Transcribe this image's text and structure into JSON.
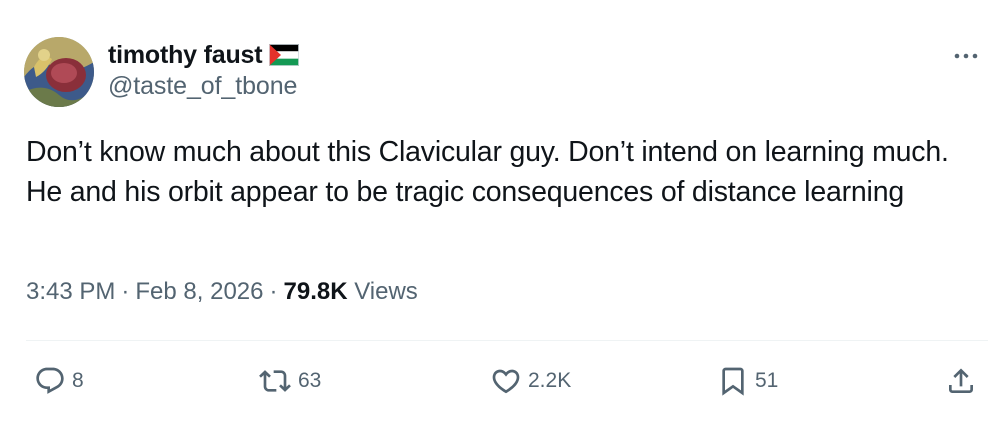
{
  "author": {
    "display_name": "timothy faust",
    "handle": "@taste_of_tbone",
    "flag_icon": "palestine-flag-icon",
    "avatar": "avatar-image"
  },
  "tweet": {
    "text": "Don’t know much about this Clavicular guy. Don’t intend on learning much. He and his orbit appear to be tragic consequences of distance learning"
  },
  "meta": {
    "time": "3:43 PM",
    "separator": "·",
    "date": "Feb 8, 2026",
    "views_count": "79.8K",
    "views_label": "Views"
  },
  "actions": {
    "reply": {
      "icon": "reply-icon",
      "count": "8"
    },
    "retweet": {
      "icon": "retweet-icon",
      "count": "63"
    },
    "like": {
      "icon": "heart-icon",
      "count": "2.2K"
    },
    "bookmark": {
      "icon": "bookmark-icon",
      "count": "51"
    },
    "share": {
      "icon": "share-icon"
    }
  },
  "more_icon": "more-dots-icon",
  "colors": {
    "text_primary": "#0f1419",
    "text_secondary": "#536471",
    "divider": "#eff3f4"
  }
}
